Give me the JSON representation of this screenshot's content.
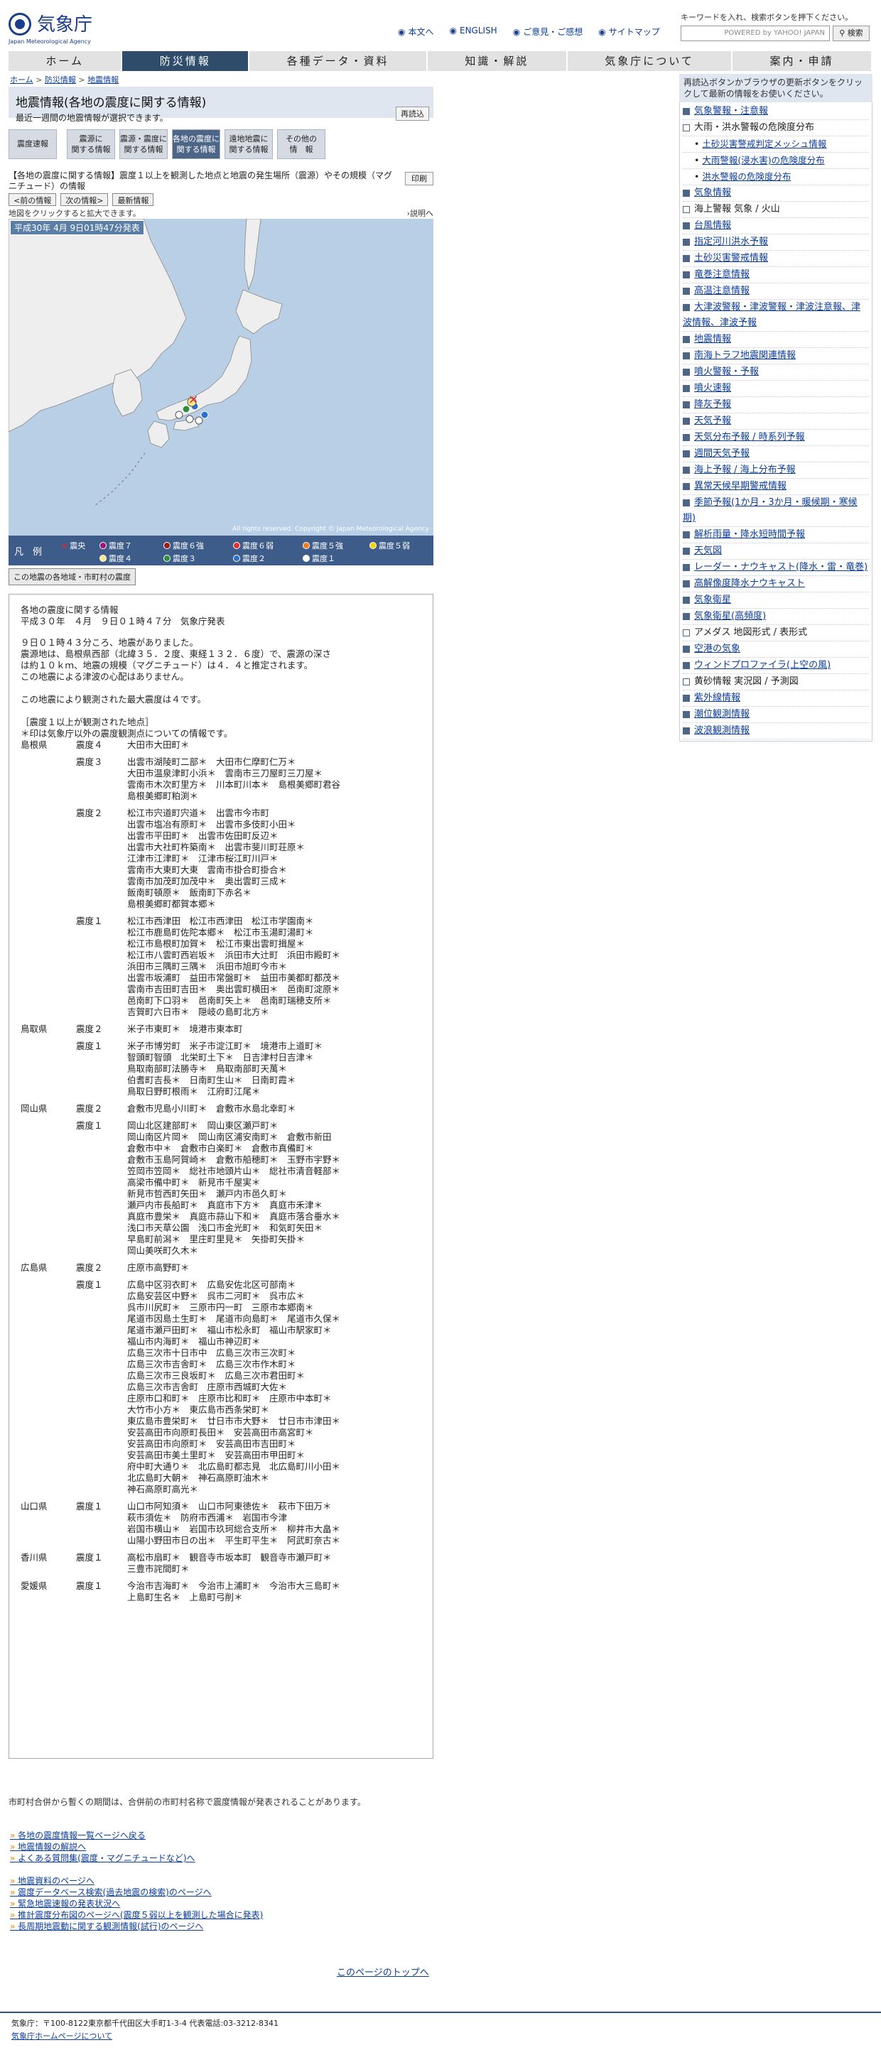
{
  "header": {
    "logo_jp": "気象庁",
    "logo_en": "Japan Meteorological Agency",
    "links": [
      "本文へ",
      "ENGLISH",
      "ご意見・ご感想",
      "サイトマップ"
    ],
    "search_hint": "キーワードを入れ、検索ボタンを押下ください。",
    "search_placeholder": "POWERED by YAHOO! JAPAN",
    "search_button": "検索"
  },
  "nav": [
    "ホーム",
    "防災情報",
    "各種データ・資料",
    "知識・解説",
    "気象庁について",
    "案内・申請"
  ],
  "breadcrumb": [
    "ホーム",
    "防災情報",
    "地震情報"
  ],
  "page": {
    "title": "地震情報(各地の震度に関する情報)",
    "subtitle": "最近一週間の地震情報が選択できます。",
    "reload": "再読込"
  },
  "tabs": [
    {
      "l1": "震度速報",
      "l2": ""
    },
    {
      "l1": "震源に",
      "l2": "関する情報"
    },
    {
      "l1": "震源・震度に",
      "l2": "関する情報"
    },
    {
      "l1": "各地の震度に",
      "l2": "関する情報"
    },
    {
      "l1": "遠地地震に",
      "l2": "関する情報"
    },
    {
      "l1": "その他の",
      "l2": "情　報"
    }
  ],
  "info": {
    "text": "【各地の震度に関する情報】震度１以上を観測した地点と地震の発生場所（震源）やその規模（マグニチュード）の情報",
    "print": "印刷",
    "prev": "<前の情報",
    "next": "次の情報>",
    "latest": "最新情報",
    "zoom_hint": "地図をクリックすると拡大できます。",
    "explain": "説明へ"
  },
  "map": {
    "caption": "平成30年 4月 9日01時47分発表",
    "copyright": "All rights reserved. Copyright © Japan Meteorological Agency",
    "legend_title": "凡　例",
    "legend": [
      {
        "label": "震央",
        "color": "#e8262a"
      },
      {
        "label": "震度７",
        "color": "#a0127a"
      },
      {
        "label": "震度６強",
        "color": "#9a1d1d"
      },
      {
        "label": "震度６弱",
        "color": "#e03030"
      },
      {
        "label": "震度５強",
        "color": "#f07c1e"
      },
      {
        "label": "震度５弱",
        "color": "#f5d200"
      },
      {
        "label": "震度４",
        "color": "#f7e98a"
      },
      {
        "label": "震度３",
        "color": "#2d8f3a"
      },
      {
        "label": "震度２",
        "color": "#2c6fd1"
      },
      {
        "label": "震度１",
        "color": "#ffffff"
      }
    ],
    "muni_button": "この地震の各地域・市町村の震度"
  },
  "report": {
    "head": "各地の震度に関する情報\n平成３０年　４月　９日０１時４７分　気象庁発表",
    "body": "９日０１時４３分ころ、地震がありました。\n震源地は、島根県西部（北緯３５．２度、東経１３２．６度）で、震源の深さ\nは約１０ｋｍ、地震の規模（マグニチュード）は４．４と推定されます。\nこの地震による津波の心配はありません。\n\nこの地震により観測された最大震度は４です。\n\n［震度１以上が観測された地点］\n＊印は気象庁以外の震度観測点についての情報です。",
    "rows": [
      {
        "pref": "島根県",
        "int": "震度４",
        "places": "大田市大田町＊"
      },
      {
        "pref": "",
        "int": "震度３",
        "places": "出雲市湖陵町二部＊　大田市仁摩町仁万＊\n大田市温泉津町小浜＊　雲南市三刀屋町三刀屋＊\n雲南市木次町里方＊　川本町川本＊　島根美郷町君谷\n島根美郷町粕渕＊"
      },
      {
        "pref": "",
        "int": "震度２",
        "places": "松江市宍道町宍道＊　出雲市今市町\n出雲市塩冶有原町＊　出雲市多伎町小田＊\n出雲市平田町＊　出雲市佐田町反辺＊\n出雲市大社町杵築南＊　出雲市斐川町荘原＊\n江津市江津町＊　江津市桜江町川戸＊\n雲南市大東町大東　雲南市掛合町掛合＊\n雲南市加茂町加茂中＊　奥出雲町三成＊\n飯南町頓原＊　飯南町下赤名＊\n島根美郷町都賀本郷＊"
      },
      {
        "pref": "",
        "int": "震度１",
        "places": "松江市西津田　松江市西津田　松江市学園南＊\n松江市鹿島町佐陀本郷＊　松江市玉湯町湯町＊\n松江市島根町加賀＊　松江市東出雲町揖屋＊\n松江市八雲町西岩坂＊　浜田市大辻町　浜田市殿町＊\n浜田市三隅町三隅＊　浜田市旭町今市＊\n出雲市坂浦町　益田市常盤町＊　益田市美都町都茂＊\n雲南市吉田町吉田＊　奥出雲町横田＊　邑南町淀原＊\n邑南町下口羽＊　邑南町矢上＊　邑南町瑞穂支所＊\n吉賀町六日市＊　隠岐の島町北方＊"
      },
      {
        "pref": "鳥取県",
        "int": "震度２",
        "places": "米子市東町＊　境港市東本町"
      },
      {
        "pref": "",
        "int": "震度１",
        "places": "米子市博労町　米子市淀江町＊　境港市上道町＊\n智頭町智頭　北栄町土下＊　日吉津村日吉津＊\n鳥取南部町法勝寺＊　鳥取南部町天萬＊\n伯耆町吉長＊　日南町生山＊　日南町霞＊\n鳥取日野町根雨＊　江府町江尾＊"
      },
      {
        "pref": "岡山県",
        "int": "震度２",
        "places": "倉敷市児島小川町＊　倉敷市水島北幸町＊"
      },
      {
        "pref": "",
        "int": "震度１",
        "places": "岡山北区建部町＊　岡山東区瀬戸町＊\n岡山南区片岡＊　岡山南区浦安南町＊　倉敷市新田\n倉敷市中＊　倉敷市白楽町＊　倉敷市真備町＊\n倉敷市玉島阿賀崎＊　倉敷市船穂町＊　玉野市宇野＊\n笠岡市笠岡＊　総社市地頭片山＊　総社市清音軽部＊\n高梁市備中町＊　新見市千屋実＊\n新見市哲西町矢田＊　瀬戸内市邑久町＊\n瀬戸内市長船町＊　真庭市下方＊　真庭市禾津＊\n真庭市豊栄＊　真庭市蒜山下和＊　真庭市落合垂水＊\n浅口市天草公園　浅口市金光町＊　和気町矢田＊\n早島町前潟＊　里庄町里見＊　矢掛町矢掛＊\n岡山美咲町久木＊"
      },
      {
        "pref": "広島県",
        "int": "震度２",
        "places": "庄原市高野町＊"
      },
      {
        "pref": "",
        "int": "震度１",
        "places": "広島中区羽衣町＊　広島安佐北区可部南＊\n広島安芸区中野＊　呉市二河町＊　呉市広＊\n呉市川尻町＊　三原市円一町　三原市本郷南＊\n尾道市因島土生町＊　尾道市向島町＊　尾道市久保＊\n尾道市瀬戸田町＊　福山市松永町　福山市駅家町＊\n福山市内海町＊　福山市神辺町＊\n広島三次市十日市中　広島三次市三次町＊\n広島三次市吉舎町＊　広島三次市作木町＊\n広島三次市三良坂町＊　広島三次市君田町＊\n広島三次市吉舎町　庄原市西城町大佐＊\n庄原市口和町＊　庄原市比和町＊　庄原市中本町＊\n大竹市小方＊　東広島市西条栄町＊\n東広島市豊栄町＊　廿日市市大野＊　廿日市市津田＊\n安芸高田市向原町長田＊　安芸高田市高宮町＊\n安芸高田市向原町＊　安芸高田市吉田町＊\n安芸高田市美土里町＊　安芸高田市甲田町＊\n府中町大通り＊　北広島町都志見　北広島町川小田＊\n北広島町大朝＊　神石高原町油木＊\n神石高原町高光＊"
      },
      {
        "pref": "山口県",
        "int": "震度１",
        "places": "山口市阿知須＊　山口市阿東徳佐＊　萩市下田万＊\n萩市須佐＊　防府市西浦＊　岩国市今津\n岩国市横山＊　岩国市玖珂総合支所＊　柳井市大畠＊\n山陽小野田市日の出＊　平生町平生＊　阿武町奈古＊"
      },
      {
        "pref": "香川県",
        "int": "震度１",
        "places": "高松市扇町＊　観音寺市坂本町　観音寺市瀬戸町＊\n三豊市詫間町＊"
      },
      {
        "pref": "愛媛県",
        "int": "震度１",
        "places": "今治市吉海町＊　今治市上浦町＊　今治市大三島町＊\n上島町生名＊　上島町弓削＊"
      }
    ]
  },
  "notice": "市町村合併から暫くの期間は、合併前の市町村名称で震度情報が発表されることがあります。",
  "links1": [
    "各地の震度情報一覧ページへ戻る",
    "地震情報の解説へ",
    "よくある質問集(震度・マグニチュードなど)へ"
  ],
  "links2": [
    "地震資料のページへ",
    "震度データベース検索(過去地震の検索)のページへ",
    "緊急地震速報の発表状況へ",
    "推計震度分布図のページへ(震度５弱以上を観測した場合に発表)",
    "長周期地震動に関する観測情報(試行)のページへ"
  ],
  "pagetop": "このページのトップへ",
  "footer": {
    "address": "気象庁：〒100-8122東京都千代田区大手町1-3-4 代表電話:03-3212-8341",
    "home": "気象庁ホームページについて"
  },
  "side": {
    "intro": "再読込ボタンかブラウザの更新ボタンをクリックして最新の情報をお使いください。",
    "items": [
      {
        "t": "気象警報・注意報",
        "sub": false,
        "link": true
      },
      {
        "t": "大雨・洪水警報の危険度分布",
        "sub": false,
        "link": false
      },
      {
        "t": "土砂災害警戒判定メッシュ情報",
        "sub": true,
        "link": true
      },
      {
        "t": "大雨警報(浸水害)の危険度分布",
        "sub": true,
        "link": true
      },
      {
        "t": "洪水警報の危険度分布",
        "sub": true,
        "link": true
      },
      {
        "t": "気象情報",
        "sub": false,
        "link": true
      },
      {
        "t": "海上警報 気象 / 火山",
        "sub": false,
        "link": false
      },
      {
        "t": "台風情報",
        "sub": false,
        "link": true
      },
      {
        "t": "指定河川洪水予報",
        "sub": false,
        "link": true
      },
      {
        "t": "土砂災害警戒情報",
        "sub": false,
        "link": true
      },
      {
        "t": "竜巻注意情報",
        "sub": false,
        "link": true
      },
      {
        "t": "高温注意情報",
        "sub": false,
        "link": true
      },
      {
        "t": "大津波警報・津波警報・津波注意報、津波情報、津波予報",
        "sub": false,
        "link": true
      },
      {
        "t": "地震情報",
        "sub": false,
        "link": true
      },
      {
        "t": "南海トラフ地震関連情報",
        "sub": false,
        "link": true
      },
      {
        "t": "噴火警報・予報",
        "sub": false,
        "link": true
      },
      {
        "t": "噴火速報",
        "sub": false,
        "link": true
      },
      {
        "t": "降灰予報",
        "sub": false,
        "link": true
      },
      {
        "t": "天気予報",
        "sub": false,
        "link": true
      },
      {
        "t": "天気分布予報 / 時系列予報",
        "sub": false,
        "link": true
      },
      {
        "t": "週間天気予報",
        "sub": false,
        "link": true
      },
      {
        "t": "海上予報 / 海上分布予報",
        "sub": false,
        "link": true
      },
      {
        "t": "異常天候早期警戒情報",
        "sub": false,
        "link": true
      },
      {
        "t": "季節予報(1か月・3か月・暖候期・寒候期)",
        "sub": false,
        "link": true
      },
      {
        "t": "解析雨量・降水短時間予報",
        "sub": false,
        "link": true
      },
      {
        "t": "天気図",
        "sub": false,
        "link": true
      },
      {
        "t": "レーダー・ナウキャスト(降水・雷・竜巻)",
        "sub": false,
        "link": true
      },
      {
        "t": "高解像度降水ナウキャスト",
        "sub": false,
        "link": true
      },
      {
        "t": "気象衛星",
        "sub": false,
        "link": true
      },
      {
        "t": "気象衛星(高頻度)",
        "sub": false,
        "link": true
      },
      {
        "t": "アメダス 地図形式 / 表形式",
        "sub": false,
        "link": false
      },
      {
        "t": "空港の気象",
        "sub": false,
        "link": true
      },
      {
        "t": "ウィンドプロファイラ(上空の風)",
        "sub": false,
        "link": true
      },
      {
        "t": "黄砂情報 実況図 / 予測図",
        "sub": false,
        "link": false
      },
      {
        "t": "紫外線情報",
        "sub": false,
        "link": true
      },
      {
        "t": "潮位観測情報",
        "sub": false,
        "link": true
      },
      {
        "t": "波浪観測情報",
        "sub": false,
        "link": true
      }
    ]
  }
}
